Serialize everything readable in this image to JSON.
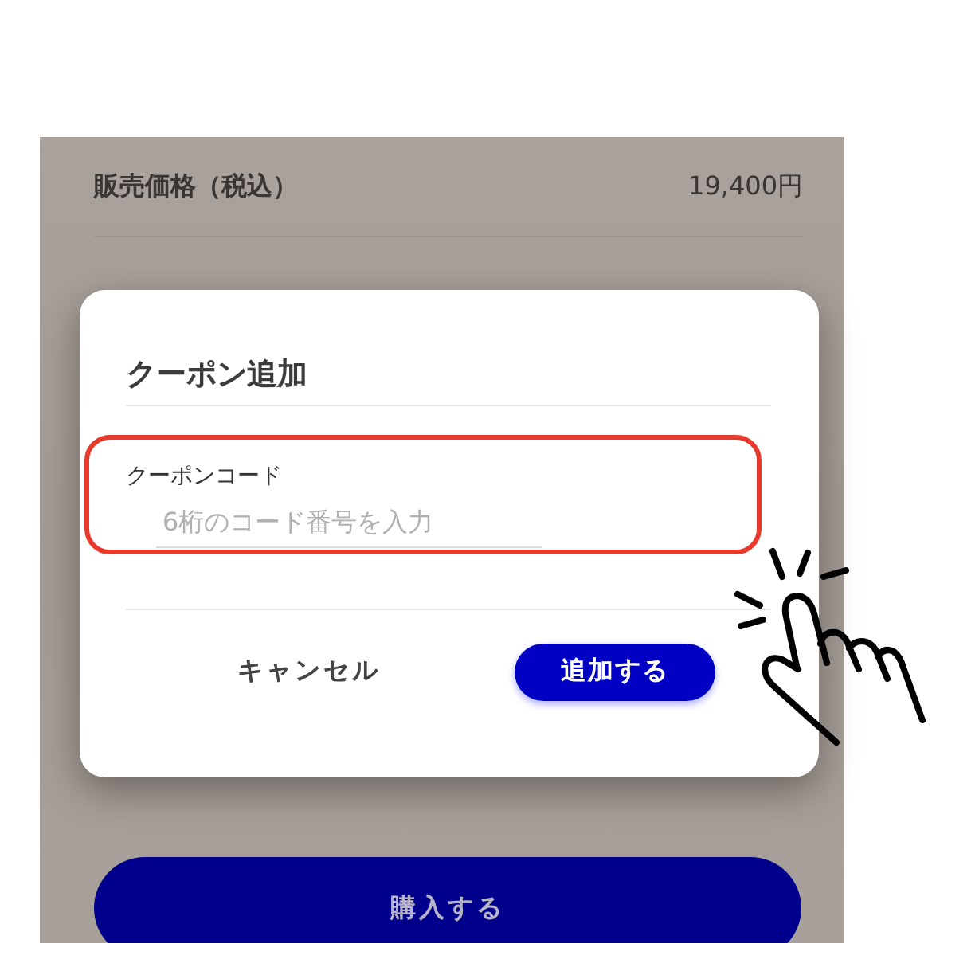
{
  "price_rows": [
    {
      "label": "販売価格（税込）",
      "value": "19,400円"
    }
  ],
  "purchase_button": "購入する",
  "dialog": {
    "title": "クーポン追加",
    "field": {
      "label": "クーポンコード",
      "placeholder": "6桁のコード番号を入力"
    },
    "highlighted": true,
    "buttons": [
      {
        "label": "キャンセル",
        "kind": "text"
      },
      {
        "label": "追加する",
        "kind": "primary"
      }
    ]
  }
}
